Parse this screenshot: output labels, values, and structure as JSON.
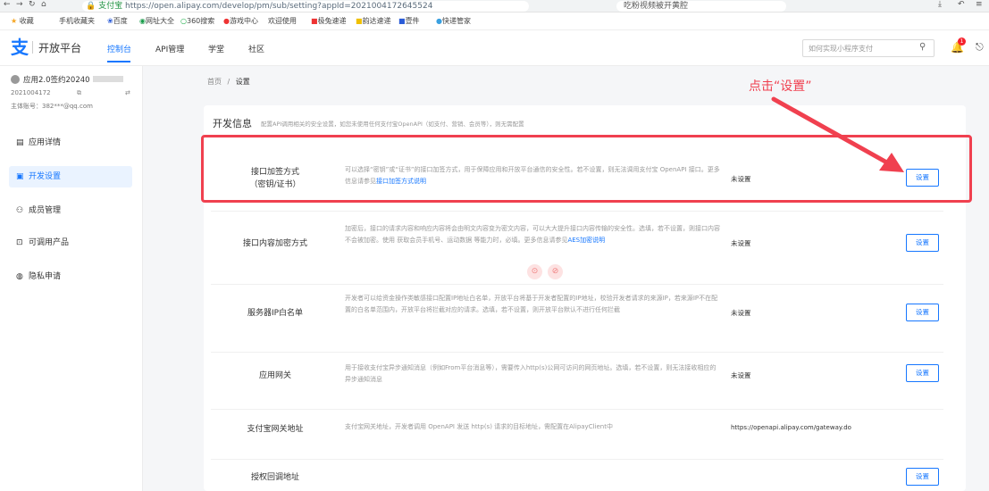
{
  "browser": {
    "tab_title": "支付宝",
    "url": "https://open.alipay.com/develop/pm/sub/setting?appId=2021004172645524",
    "search_text": "吃粉视频被开黄腔",
    "bookmarks": [
      "收藏",
      "手机收藏夹",
      "百度",
      "网址大全",
      "360搜索",
      "游戏中心",
      "欢迎使用",
      "极兔速递",
      "韵达速递",
      "壹件",
      "快递管家"
    ]
  },
  "header": {
    "logo_text": "开放平台",
    "nav": [
      "控制台",
      "API管理",
      "学堂",
      "社区"
    ],
    "active_nav": "控制台",
    "search_placeholder": "如何实现小程序支付",
    "notify_count": "1"
  },
  "sidebar": {
    "app_name": "应用2.0签约20240",
    "app_id": "2021004172",
    "account": "主体账号：382***@qq.com",
    "items": [
      {
        "label": "应用详情",
        "icon": "document-icon",
        "active": false
      },
      {
        "label": "开发设置",
        "icon": "code-icon",
        "active": true
      },
      {
        "label": "成员管理",
        "icon": "users-icon",
        "active": false
      },
      {
        "label": "可调用产品",
        "icon": "product-icon",
        "active": false
      },
      {
        "label": "隐私申请",
        "icon": "shield-icon",
        "active": false
      }
    ]
  },
  "breadcrumb": {
    "home": "首页",
    "sep": "/",
    "current": "设置"
  },
  "annotation": {
    "text": "点击“设置”",
    "color": "#f0404f"
  },
  "section": {
    "title": "开发信息",
    "subtitle": "配置API调用相关的安全设置，如您未使用任何支付宝OpenAPI（如支付、营销、会员等），则无需配置"
  },
  "rows": [
    {
      "label_line1": "接口加签方式",
      "label_line2": "（密钥/证书）",
      "desc": "可以选择“密钥”或“证书”的接口加签方式，用于保障应用和开放平台通信的安全性。若不设置，则无法调用支付宝 OpenAPI 接口。更多信息请参见",
      "desc_link": "接口加签方式说明",
      "value": "未设置",
      "button": "设置"
    },
    {
      "label_line1": "接口内容加密方式",
      "label_line2": "",
      "desc": "加密后，接口的请求内容和响应内容将会由明文内容变为密文内容，可以大大提升接口内容传输的安全性。选填，若不设置，则接口内容不会被加密。使用 获取会员手机号、运动数据 等能力时，必填。更多信息请参见",
      "desc_link": "AES加密说明",
      "value": "未设置",
      "button": "设置"
    },
    {
      "label_line1": "服务器IP白名单",
      "label_line2": "",
      "desc": "开发者可以给资金操作类敏感接口配置IP地址白名单，开放平台将基于开发者配置的IP地址，校验开发者请求的来源IP，若来源IP不在配置的白名单范围内，开放平台将拦截对应的请求。选填，若不设置，则开放平台默认不进行任何拦截",
      "desc_link": "",
      "value": "未设置",
      "button": "设置"
    },
    {
      "label_line1": "应用网关",
      "label_line2": "",
      "desc": "用于接收支付宝异步通知消息（例如From平台消息等），需要传入http(s)公网可访问的网页地址。选填，若不设置，则无法接收相应的异步通知消息",
      "desc_link": "",
      "value": "未设置",
      "button": "设置"
    },
    {
      "label_line1": "支付宝网关地址",
      "label_line2": "",
      "desc": "支付宝网关地址，开发者调用 OpenAPI 发送 http(s) 请求的目标地址，需配置在AlipayClient中",
      "desc_link": "",
      "value": "https://openapi.alipay.com/gateway.do",
      "button": ""
    },
    {
      "label_line1": "授权回调地址",
      "label_line2": "",
      "desc": "",
      "desc_link": "",
      "value": "",
      "button": "设置"
    }
  ]
}
